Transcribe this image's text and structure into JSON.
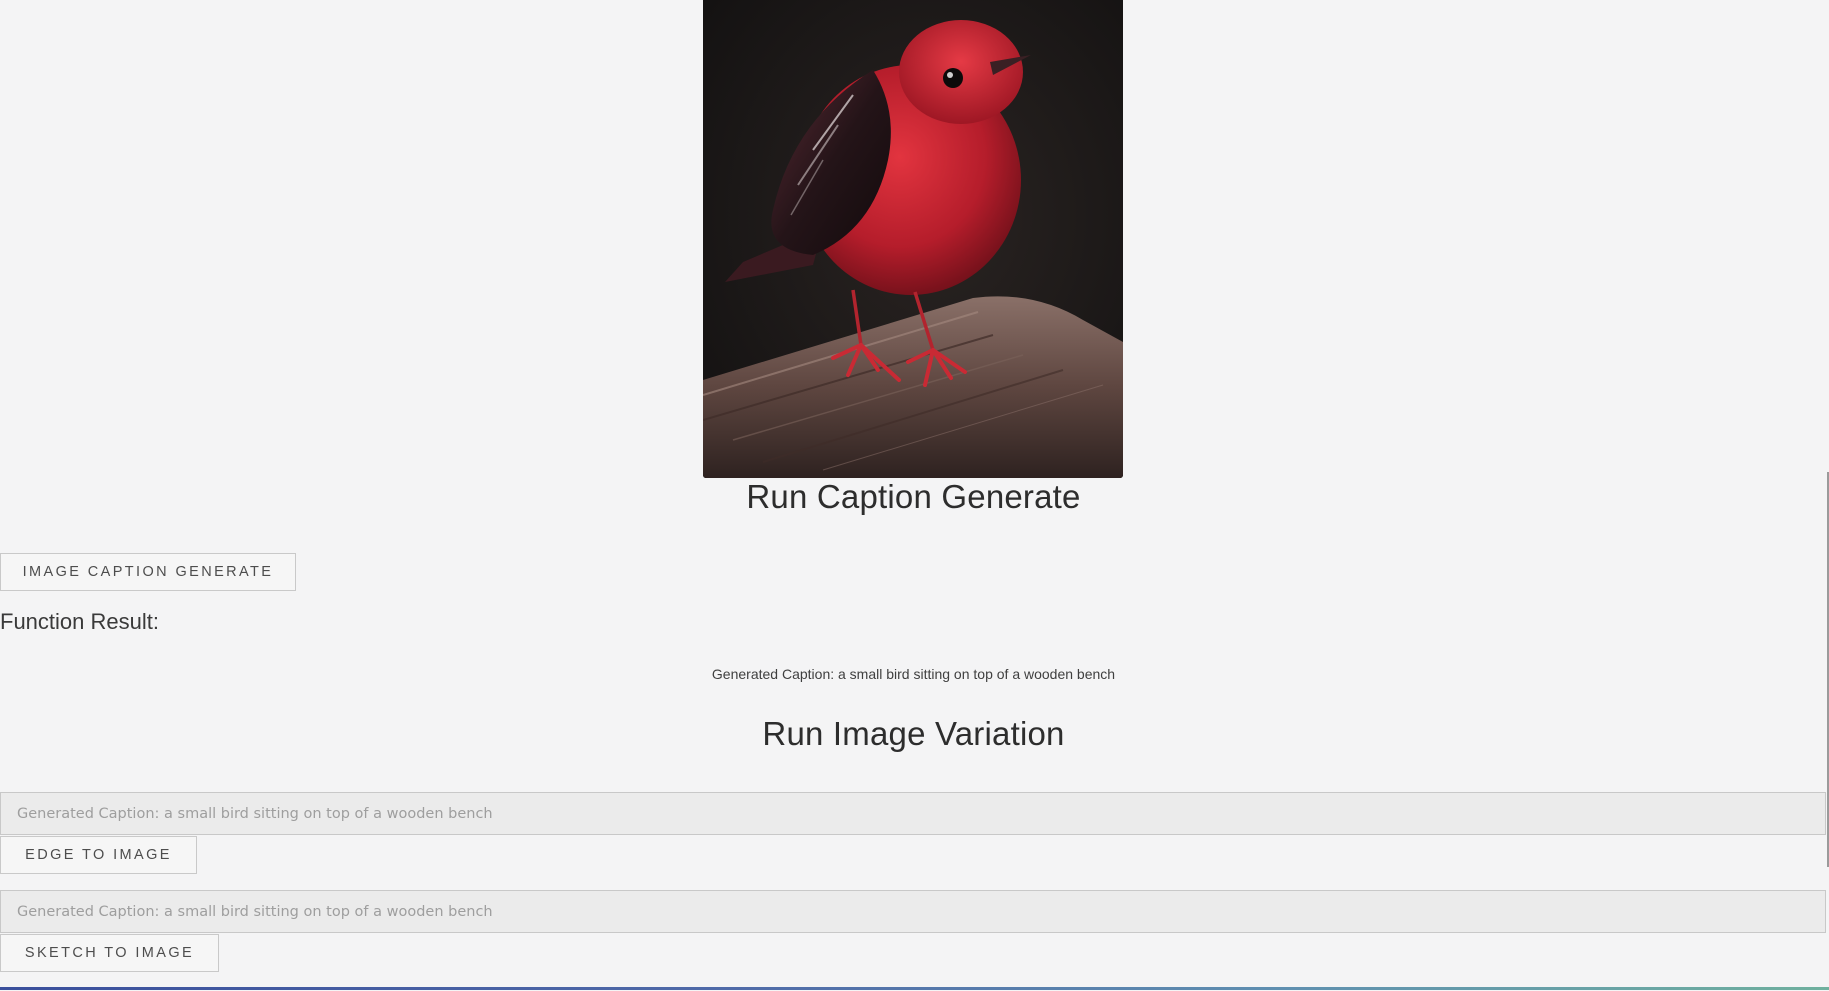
{
  "image": {
    "alt": "Red bird perched on a wooden post",
    "icon": "bird-photo"
  },
  "caption_section": {
    "title": "Run Caption Generate",
    "button_label": "IMAGE CAPTION GENERATE",
    "result_label": "Function Result:",
    "result_text": "Generated Caption: a small bird sitting on top of a wooden bench"
  },
  "variation_section": {
    "title": "Run Image Variation",
    "edge_input_placeholder": "Generated Caption: a small bird sitting on top of a wooden bench",
    "edge_button_label": "EDGE TO IMAGE",
    "sketch_input_placeholder": "Generated Caption: a small bird sitting on top of a wooden bench",
    "sketch_button_label": "SKETCH TO IMAGE"
  },
  "colors": {
    "background": "#f4f4f5",
    "bird_red": "#c3202e",
    "bottom_rule_start": "#3a4f9c",
    "bottom_rule_end": "#6fb09e"
  }
}
